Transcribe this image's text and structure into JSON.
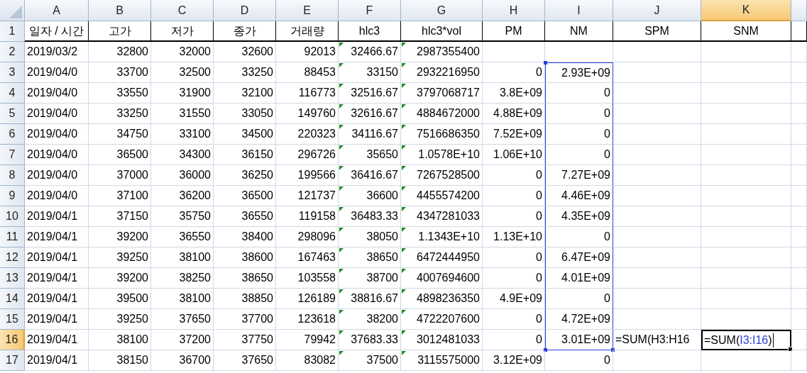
{
  "columns": [
    {
      "label": "A",
      "selected": false
    },
    {
      "label": "B",
      "selected": false
    },
    {
      "label": "C",
      "selected": false
    },
    {
      "label": "D",
      "selected": false
    },
    {
      "label": "E",
      "selected": false
    },
    {
      "label": "F",
      "selected": false
    },
    {
      "label": "G",
      "selected": false
    },
    {
      "label": "H",
      "selected": false
    },
    {
      "label": "I",
      "selected": false
    },
    {
      "label": "J",
      "selected": false
    },
    {
      "label": "K",
      "selected": true
    }
  ],
  "rows": [
    {
      "number": "1",
      "kind": "header",
      "selected": false,
      "cells": {
        "A": "일자 / 시간",
        "B": "고가",
        "C": "저가",
        "D": "종가",
        "E": "거래량",
        "F": "hlc3",
        "G": "hlc3*vol",
        "H": "PM",
        "I": "NM",
        "J": "SPM",
        "K": "SNM"
      }
    },
    {
      "number": "2",
      "kind": "data",
      "selected": false,
      "flagged": true,
      "in_range": false,
      "cells": {
        "A": "2019/03/2",
        "B": "32800",
        "C": "32000",
        "D": "32600",
        "E": "92013",
        "F": "32466.67",
        "G": "2987355400"
      }
    },
    {
      "number": "3",
      "kind": "data",
      "selected": false,
      "flagged": true,
      "in_range": true,
      "cells": {
        "A": "2019/04/0",
        "B": "33700",
        "C": "32500",
        "D": "33250",
        "E": "88453",
        "F": "33150",
        "G": "2932216950",
        "H": "0",
        "I": "2.93E+09"
      }
    },
    {
      "number": "4",
      "kind": "data",
      "selected": false,
      "flagged": true,
      "in_range": true,
      "cells": {
        "A": "2019/04/0",
        "B": "33550",
        "C": "31900",
        "D": "32100",
        "E": "116773",
        "F": "32516.67",
        "G": "3797068717",
        "H": "3.8E+09",
        "I": "0"
      }
    },
    {
      "number": "5",
      "kind": "data",
      "selected": false,
      "flagged": true,
      "in_range": true,
      "cells": {
        "A": "2019/04/0",
        "B": "33250",
        "C": "31550",
        "D": "33050",
        "E": "149760",
        "F": "32616.67",
        "G": "4884672000",
        "H": "4.88E+09",
        "I": "0"
      }
    },
    {
      "number": "6",
      "kind": "data",
      "selected": false,
      "flagged": true,
      "in_range": true,
      "cells": {
        "A": "2019/04/0",
        "B": "34750",
        "C": "33100",
        "D": "34500",
        "E": "220323",
        "F": "34116.67",
        "G": "7516686350",
        "H": "7.52E+09",
        "I": "0"
      }
    },
    {
      "number": "7",
      "kind": "data",
      "selected": false,
      "flagged": true,
      "in_range": true,
      "cells": {
        "A": "2019/04/0",
        "B": "36500",
        "C": "34300",
        "D": "36150",
        "E": "296726",
        "F": "35650",
        "G": "1.0578E+10",
        "H": "1.06E+10",
        "I": "0"
      }
    },
    {
      "number": "8",
      "kind": "data",
      "selected": false,
      "flagged": true,
      "in_range": true,
      "cells": {
        "A": "2019/04/0",
        "B": "37000",
        "C": "36000",
        "D": "36250",
        "E": "199566",
        "F": "36416.67",
        "G": "7267528500",
        "H": "0",
        "I": "7.27E+09"
      }
    },
    {
      "number": "9",
      "kind": "data",
      "selected": false,
      "flagged": true,
      "in_range": true,
      "cells": {
        "A": "2019/04/0",
        "B": "37100",
        "C": "36200",
        "D": "36500",
        "E": "121737",
        "F": "36600",
        "G": "4455574200",
        "H": "0",
        "I": "4.46E+09"
      }
    },
    {
      "number": "10",
      "kind": "data",
      "selected": false,
      "flagged": true,
      "in_range": true,
      "cells": {
        "A": "2019/04/1",
        "B": "37150",
        "C": "35750",
        "D": "36550",
        "E": "119158",
        "F": "36483.33",
        "G": "4347281033",
        "H": "0",
        "I": "4.35E+09"
      }
    },
    {
      "number": "11",
      "kind": "data",
      "selected": false,
      "flagged": true,
      "in_range": true,
      "cells": {
        "A": "2019/04/1",
        "B": "39200",
        "C": "36550",
        "D": "38400",
        "E": "298096",
        "F": "38050",
        "G": "1.1343E+10",
        "H": "1.13E+10",
        "I": "0"
      }
    },
    {
      "number": "12",
      "kind": "data",
      "selected": false,
      "flagged": true,
      "in_range": true,
      "cells": {
        "A": "2019/04/1",
        "B": "39250",
        "C": "38100",
        "D": "38600",
        "E": "167463",
        "F": "38650",
        "G": "6472444950",
        "H": "0",
        "I": "6.47E+09"
      }
    },
    {
      "number": "13",
      "kind": "data",
      "selected": false,
      "flagged": true,
      "in_range": true,
      "cells": {
        "A": "2019/04/1",
        "B": "39200",
        "C": "38250",
        "D": "38650",
        "E": "103558",
        "F": "38700",
        "G": "4007694600",
        "H": "0",
        "I": "4.01E+09"
      }
    },
    {
      "number": "14",
      "kind": "data",
      "selected": false,
      "flagged": true,
      "in_range": true,
      "cells": {
        "A": "2019/04/1",
        "B": "39500",
        "C": "38100",
        "D": "38850",
        "E": "126189",
        "F": "38816.67",
        "G": "4898236350",
        "H": "4.9E+09",
        "I": "0"
      }
    },
    {
      "number": "15",
      "kind": "data",
      "selected": false,
      "flagged": true,
      "in_range": true,
      "cells": {
        "A": "2019/04/1",
        "B": "39250",
        "C": "37650",
        "D": "37700",
        "E": "123618",
        "F": "38200",
        "G": "4722207600",
        "H": "0",
        "I": "4.72E+09"
      }
    },
    {
      "number": "16",
      "kind": "data",
      "selected": true,
      "flagged": true,
      "in_range": true,
      "cells": {
        "A": "2019/04/1",
        "B": "38100",
        "C": "37200",
        "D": "37750",
        "E": "79942",
        "F": "37683.33",
        "G": "3012481033",
        "H": "0",
        "I": "3.01E+09",
        "J": "=SUM(H3:H16",
        "K": [
          {
            "text": "=SUM(",
            "ref": false
          },
          {
            "text": "I3:I16",
            "ref": true
          },
          {
            "text": ")",
            "ref": false
          }
        ]
      }
    },
    {
      "number": "17",
      "kind": "data",
      "selected": false,
      "flagged": true,
      "in_range": false,
      "cells": {
        "A": "2019/04/1",
        "B": "38150",
        "C": "36700",
        "D": "37650",
        "E": "83082",
        "F": "37500",
        "G": "3115575000",
        "H": "3.12E+09",
        "I": "0"
      }
    }
  ]
}
